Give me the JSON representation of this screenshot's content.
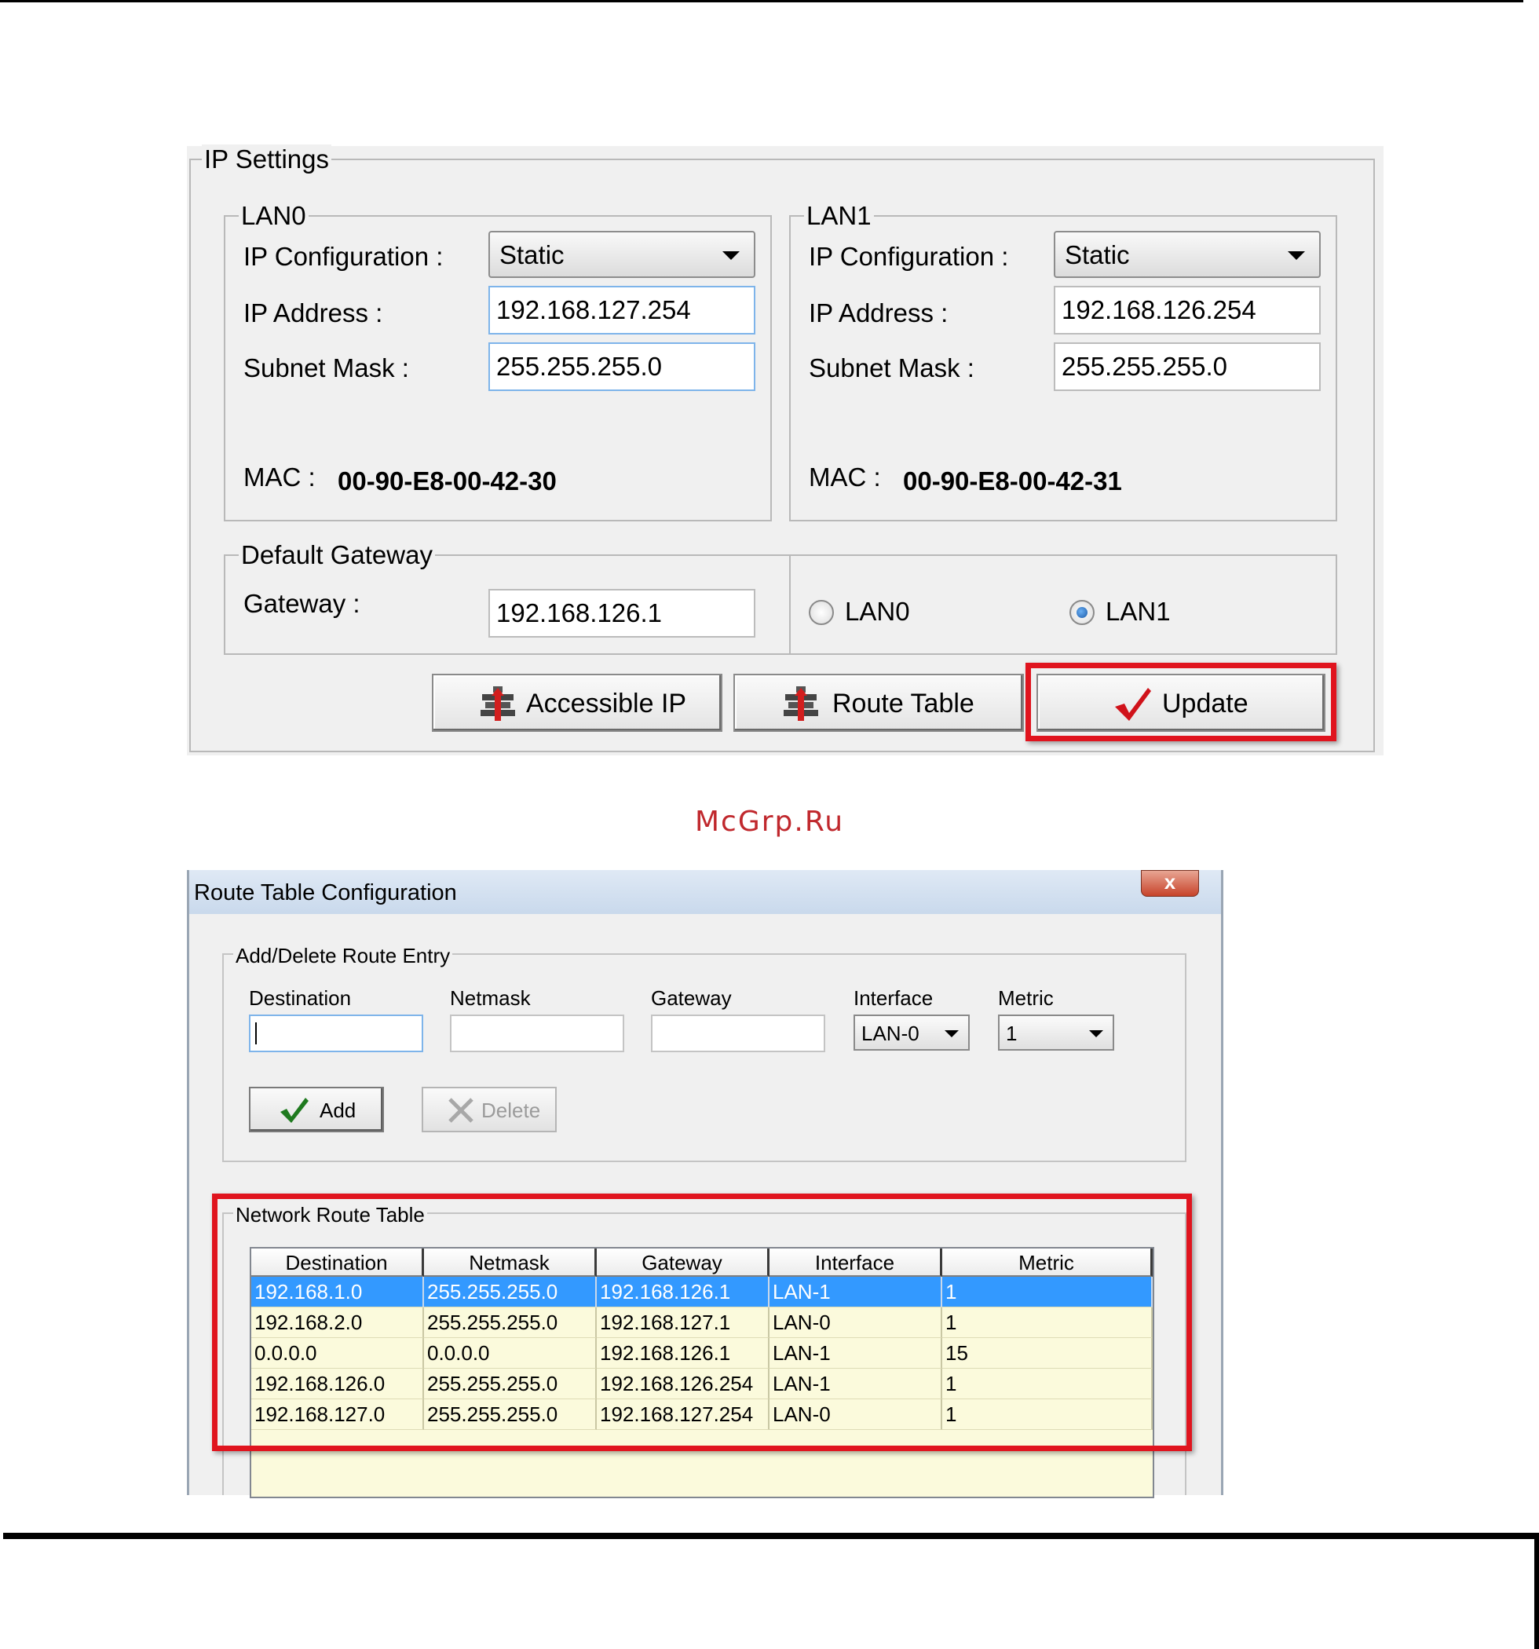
{
  "watermark": "McGrp.Ru",
  "ip_settings": {
    "title": "IP Settings",
    "lan0": {
      "title": "LAN0",
      "ip_config_label": "IP Configuration :",
      "ip_config_value": "Static",
      "ip_address_label": "IP Address :",
      "ip_address_value": "192.168.127.254",
      "subnet_label": "Subnet Mask :",
      "subnet_value": "255.255.255.0",
      "mac_label": "MAC :",
      "mac_value": "00-90-E8-00-42-30"
    },
    "lan1": {
      "title": "LAN1",
      "ip_config_label": "IP Configuration :",
      "ip_config_value": "Static",
      "ip_address_label": "IP Address :",
      "ip_address_value": "192.168.126.254",
      "subnet_label": "Subnet Mask :",
      "subnet_value": "255.255.255.0",
      "mac_label": "MAC :",
      "mac_value": "00-90-E8-00-42-31"
    },
    "gateway": {
      "title": "Default Gateway",
      "label": "Gateway :",
      "value": "192.168.126.1",
      "radio_lan0": "LAN0",
      "radio_lan1": "LAN1",
      "selected": "LAN1"
    },
    "buttons": {
      "accessible_ip": "Accessible IP",
      "route_table": "Route Table",
      "update": "Update"
    }
  },
  "route_dialog": {
    "title": "Route Table Configuration",
    "close": "x",
    "entry_group": {
      "title": "Add/Delete Route Entry",
      "destination_label": "Destination",
      "destination_value": "",
      "netmask_label": "Netmask",
      "netmask_value": "",
      "gateway_label": "Gateway",
      "gateway_value": "",
      "interface_label": "Interface",
      "interface_value": "LAN-0",
      "metric_label": "Metric",
      "metric_value": "1",
      "add_button": "Add",
      "delete_button": "Delete"
    },
    "table_group": {
      "title": "Network Route Table",
      "columns": [
        "Destination",
        "Netmask",
        "Gateway",
        "Interface",
        "Metric"
      ],
      "rows": [
        [
          "192.168.1.0",
          "255.255.255.0",
          "192.168.126.1",
          "LAN-1",
          "1"
        ],
        [
          "192.168.2.0",
          "255.255.255.0",
          "192.168.127.1",
          "LAN-0",
          "1"
        ],
        [
          "0.0.0.0",
          "0.0.0.0",
          "192.168.126.1",
          "LAN-1",
          "15"
        ],
        [
          "192.168.126.0",
          "255.255.255.0",
          "192.168.126.254",
          "LAN-1",
          "1"
        ],
        [
          "192.168.127.0",
          "255.255.255.0",
          "192.168.127.254",
          "LAN-0",
          "1"
        ]
      ],
      "selected_row": 0
    }
  },
  "colors": {
    "highlight": "#e0141e",
    "selection": "#3399ff",
    "grid_bg": "#fbfadc",
    "watermark": "#c0282d"
  },
  "icons": {
    "accessible_ip": "network-icon",
    "route_table": "network-icon",
    "update": "checkmark-icon",
    "add": "checkmark-icon",
    "delete": "x-icon"
  }
}
